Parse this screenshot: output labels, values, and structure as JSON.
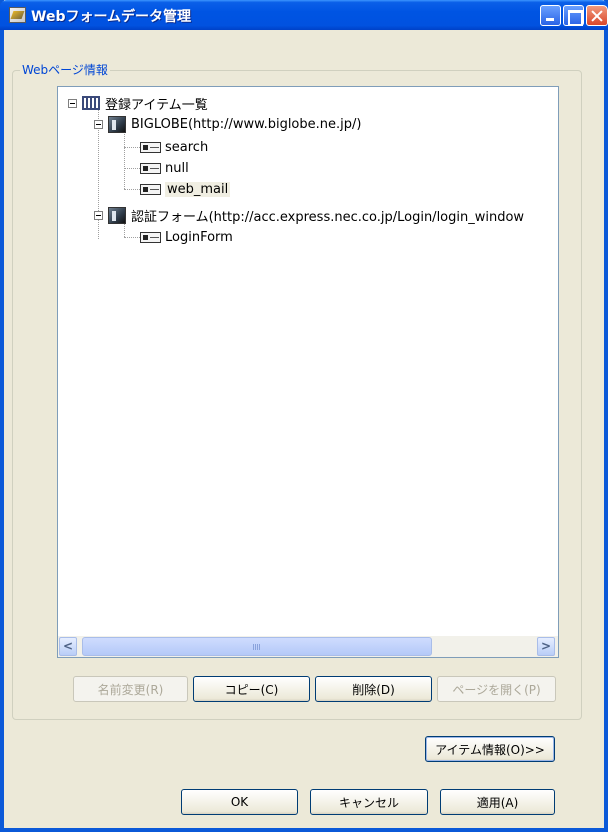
{
  "window": {
    "title": "Webフォームデータ管理"
  },
  "group": {
    "label": "Webページ情報"
  },
  "tree": {
    "root_label": "登録アイテム一覧",
    "sites": [
      {
        "label": "BIGLOBE(http://www.biglobe.ne.jp/)",
        "items": [
          "search",
          "null",
          "web_mail"
        ]
      },
      {
        "label": "認証フォーム(http://acc.express.nec.co.jp/Login/login_window",
        "items": [
          "LoginForm"
        ]
      }
    ],
    "selected_item": "web_mail"
  },
  "scrollbar": {
    "left_arrow": "<",
    "right_arrow": ">"
  },
  "buttons": {
    "rename": "名前変更(R)",
    "copy": "コピー(C)",
    "delete": "削除(D)",
    "open_page": "ページを開く(P)",
    "item_info": "アイテム情報(O)>>",
    "ok": "OK",
    "cancel": "キャンセル",
    "apply": "適用(A)"
  },
  "colors": {
    "title_bar": "#0054e3",
    "group_label": "#0046d5",
    "dialog_bg": "#ece9d8"
  }
}
